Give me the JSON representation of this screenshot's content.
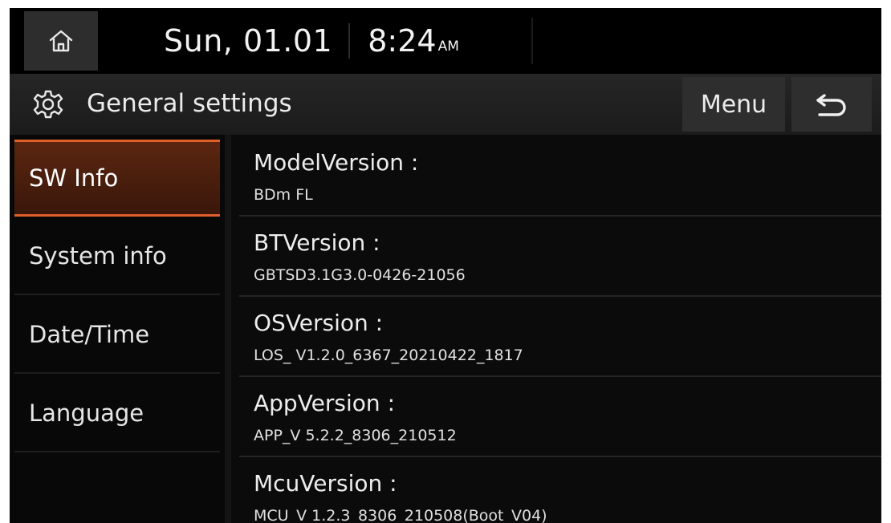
{
  "statusbar": {
    "date": "Sun, 01.01",
    "time": "8:24",
    "ampm": "AM"
  },
  "titlebar": {
    "title": "General settings",
    "menu_label": "Menu"
  },
  "sidebar": {
    "items": [
      {
        "label": "SW Info",
        "active": true
      },
      {
        "label": "System info",
        "active": false
      },
      {
        "label": "Date/Time",
        "active": false
      },
      {
        "label": "Language",
        "active": false
      }
    ]
  },
  "info": {
    "rows": [
      {
        "label": "ModelVersion :",
        "value": "BDm FL"
      },
      {
        "label": "BTVersion :",
        "value": "GBTSD3.1G3.0-0426-21056"
      },
      {
        "label": "OSVersion :",
        "value": "LOS_ V1.2.0_6367_20210422_1817"
      },
      {
        "label": "AppVersion :",
        "value": "APP_V 5.2.2_8306_210512"
      },
      {
        "label": "McuVersion :",
        "value": "MCU_V 1.2.3_8306_210508(Boot_V04)"
      }
    ]
  },
  "colors": {
    "accent": "#e0602a",
    "active_bg": "#4a1e0c",
    "background": "#0b0b0b"
  },
  "icons": {
    "home": "home-icon",
    "settings": "gear-icon",
    "back": "back-arrow-icon"
  }
}
